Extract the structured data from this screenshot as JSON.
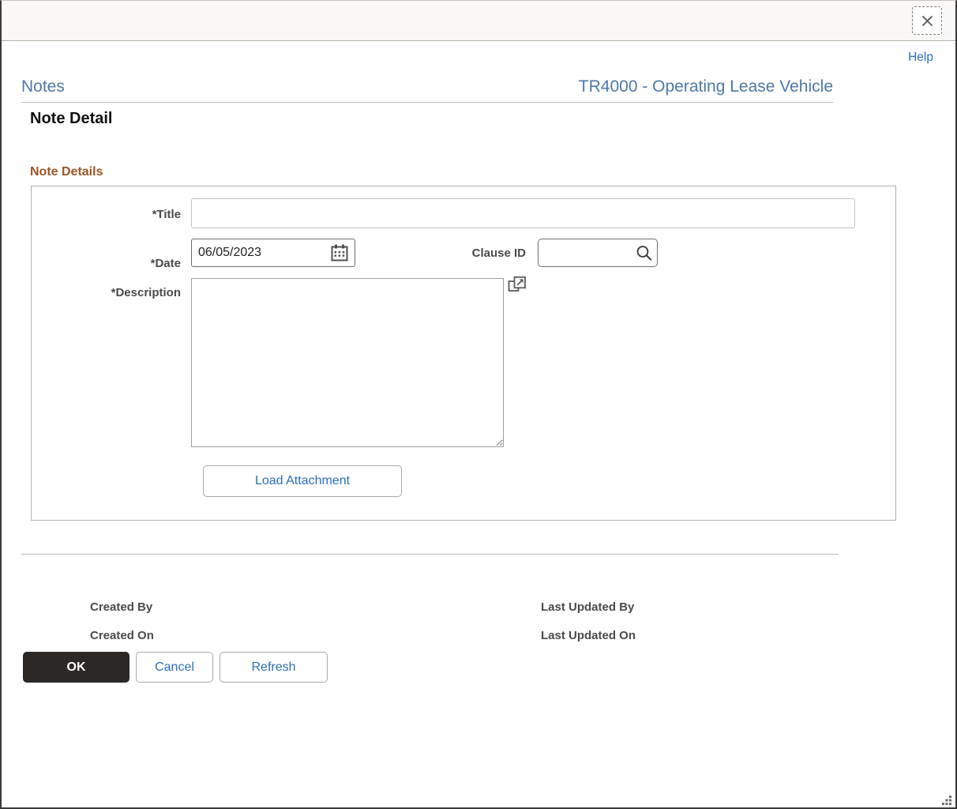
{
  "window": {
    "close_label": "Close",
    "close_icon": "close-icon",
    "resize_grip": "resize-grip"
  },
  "header": {
    "help_label": "Help",
    "breadcrumb": "Notes",
    "context_title": "TR4000 - Operating Lease Vehicle",
    "page_title": "Note Detail"
  },
  "group": {
    "label": "Note Details"
  },
  "form": {
    "title": {
      "label": "*Title",
      "value": "",
      "placeholder": ""
    },
    "date": {
      "label": "*Date",
      "value": "06/05/2023",
      "calendar_icon": "calendar-icon"
    },
    "clause_id": {
      "label": "Clause ID",
      "value": "",
      "lookup_icon": "search-icon"
    },
    "description": {
      "label": "*Description",
      "value": "",
      "expand_icon": "open-in-new-window-icon"
    },
    "load_attachment_label": "Load Attachment"
  },
  "audit": {
    "created_by_label": "Created By",
    "created_by_value": "",
    "created_on_label": "Created On",
    "created_on_value": "",
    "last_updated_by_label": "Last Updated By",
    "last_updated_by_value": "",
    "last_updated_on_label": "Last Updated On",
    "last_updated_on_value": ""
  },
  "actions": {
    "ok_label": "OK",
    "cancel_label": "Cancel",
    "refresh_label": "Refresh"
  },
  "colors": {
    "link_blue": "#2a6ebb",
    "title_blue": "#4d78a8",
    "group_label_brown": "#9a5528",
    "primary_button_bg": "#2b2825",
    "titlebar_bg": "#f9f8f6"
  }
}
